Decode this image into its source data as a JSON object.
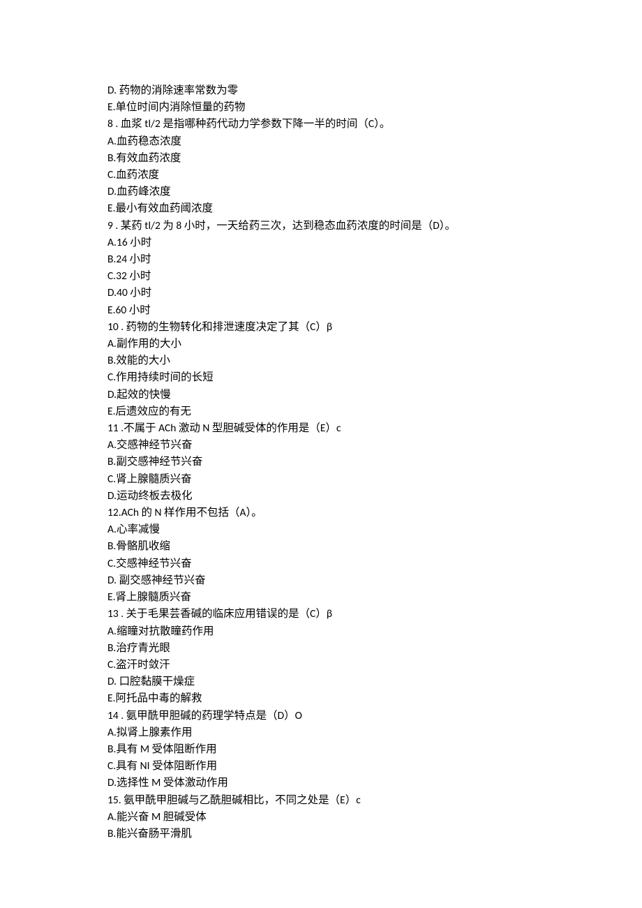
{
  "lines": [
    "D. 药物的消除速率常数为零",
    "E.单位时间内消除恒量的药物",
    "8   . 血浆 tl/2 是指哪种药代动力学参数下降一半的时间（C）。",
    "A.血药稳态浓度",
    "B.有效血药浓度",
    "C.血药浓度",
    "D.血药峰浓度",
    "E.最小有效血药阈浓度",
    "9   . 某药 tl/2 为 8 小时，一天给药三次，达到稳态血药浓度的时间是（D）。",
    "A.16 小时",
    "B.24 小时",
    "C.32 小时",
    "D.40 小时",
    "E.60 小时",
    "10   . 药物的生物转化和排泄速度决定了其（C）β",
    "A.副作用的大小",
    "B.效能的大小",
    "C.作用持续时间的长短",
    "D.起效的快慢",
    "E.后遗效应的有无",
    "11   .不属于 ACh 激动 N 型胆碱受体的作用是（E）c",
    "A.交感神经节兴奋",
    "B.副交感神经节兴奋",
    "C.肾上腺髓质兴奋",
    "D.运动终板去极化",
    "12.ACh 的 N 样作用不包括（A）。",
    "A.心率减慢",
    "B.骨骼肌收缩",
    "C.交感神经节兴奋",
    "D. 副交感神经节兴奋",
    "E.肾上腺髓质兴奋",
    "13   . 关于毛果芸香碱的临床应用错误的是（C）β",
    "A.缩瞳对抗散瞳药作用",
    "B.治疗青光眼",
    "C.盗汗时敛汗",
    "D. 口腔黏膜干燥症",
    "E.阿托品中毒的解救",
    "14   . 氨甲酰甲胆碱的药理学特点是（D）O",
    "A.拟肾上腺素作用",
    "B.具有 M 受体阻断作用",
    "C.具有 NI 受体阻断作用",
    "D.选择性 M 受体激动作用",
    "15. 氨甲酰甲胆碱与乙酰胆碱相比，不同之处是（E）c",
    "A.能兴奋 M 胆碱受体",
    "B.能兴奋肠平滑肌"
  ]
}
